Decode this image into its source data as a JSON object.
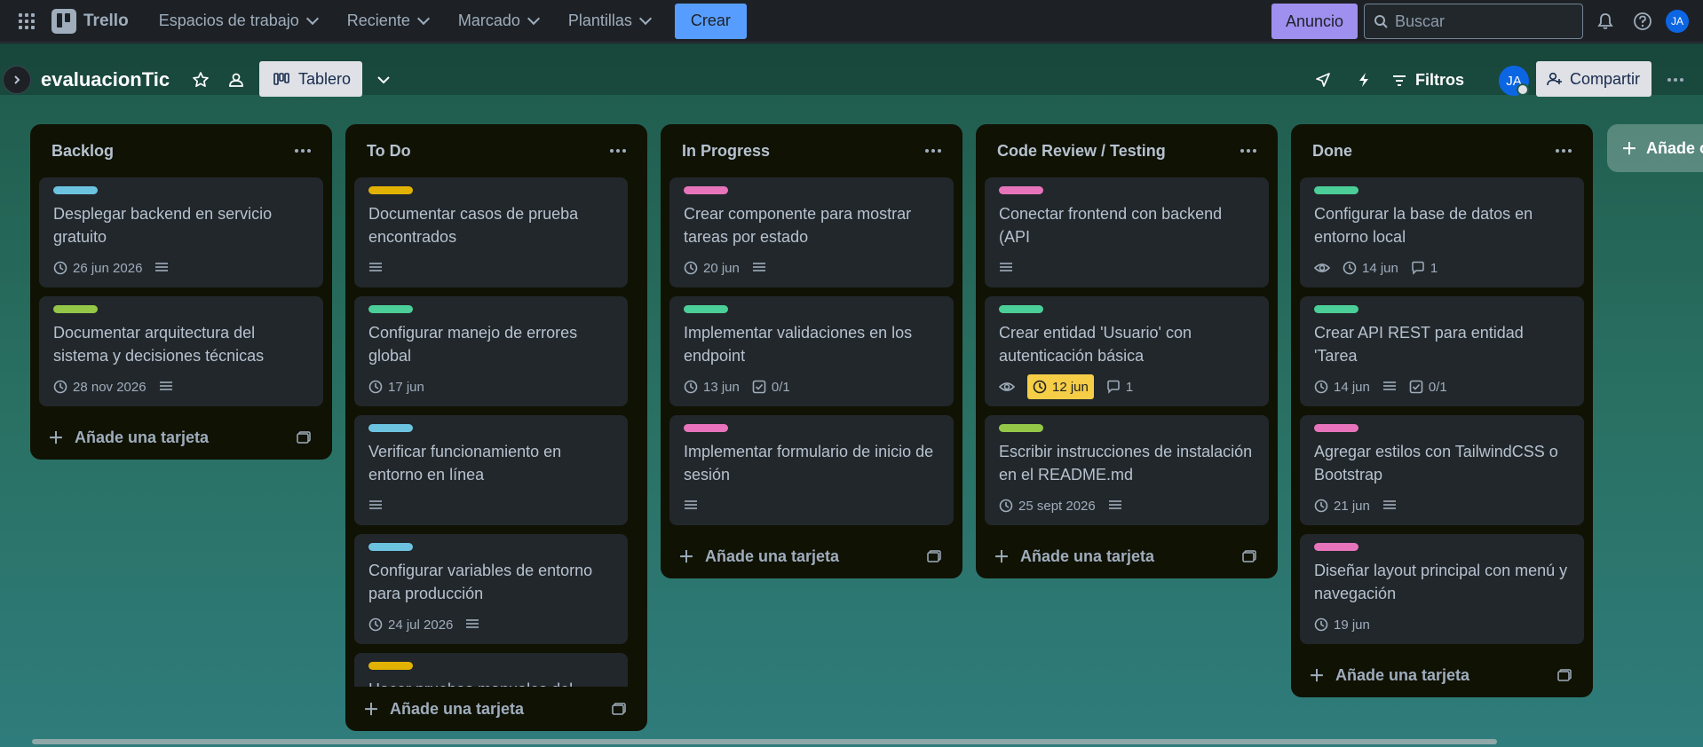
{
  "nav": {
    "app_name": "Trello",
    "menu": [
      {
        "label": "Espacios de trabajo"
      },
      {
        "label": "Reciente"
      },
      {
        "label": "Marcado"
      },
      {
        "label": "Plantillas"
      }
    ],
    "create_label": "Crear",
    "announce_label": "Anuncio",
    "search_placeholder": "Buscar",
    "user_initials": "JA"
  },
  "board": {
    "title": "evaluacionTic",
    "view_label": "Tablero",
    "filters_label": "Filtros",
    "member_initials": "JA",
    "share_label": "Compartir",
    "add_list_label": "Añade otra lista",
    "add_card_label": "Añade una tarjeta"
  },
  "colors": {
    "blue": "#6cc3e0",
    "yellow": "#e2b203",
    "green": "#4bce97",
    "lime": "#94c748",
    "pink": "#e774bb",
    "due_warning": "#f5cd47"
  },
  "lists": [
    {
      "title": "Backlog",
      "cards": [
        {
          "label_color": "#6cc3e0",
          "title": "Desplegar backend en servicio gratuito",
          "due": "26 jun 2026",
          "description": true
        },
        {
          "label_color": "#94c748",
          "title": "Documentar arquitectura del sistema y decisiones técnicas",
          "due": "28 nov 2026",
          "description": true
        }
      ]
    },
    {
      "title": "To Do",
      "cards": [
        {
          "label_color": "#e2b203",
          "title": "Documentar casos de prueba encontrados",
          "description": true
        },
        {
          "label_color": "#4bce97",
          "title": "Configurar manejo de errores global",
          "due": "17 jun"
        },
        {
          "label_color": "#6cc3e0",
          "title": "Verificar funcionamiento en entorno en línea",
          "description": true
        },
        {
          "label_color": "#6cc3e0",
          "title": "Configurar variables de entorno para producción",
          "due": "24 jul 2026",
          "description": true
        },
        {
          "label_color": "#e2b203",
          "title": "Hacer pruebas manuales del"
        }
      ]
    },
    {
      "title": "In Progress",
      "cards": [
        {
          "label_color": "#e774bb",
          "title": "Crear componente para mostrar tareas por estado",
          "due": "20 jun",
          "description": true
        },
        {
          "label_color": "#4bce97",
          "title": "Implementar validaciones en los endpoint",
          "due": "13 jun",
          "checklist": "0/1"
        },
        {
          "label_color": "#e774bb",
          "title": "Implementar formulario de inicio de sesión",
          "description": true
        }
      ]
    },
    {
      "title": "Code Review / Testing",
      "cards": [
        {
          "label_color": "#e774bb",
          "title": "Conectar frontend con backend (API",
          "description": true
        },
        {
          "label_color": "#4bce97",
          "title": "Crear entidad 'Usuario' con autenticación básica",
          "watch": true,
          "due": "12 jun",
          "due_warning": true,
          "comments": "1"
        },
        {
          "label_color": "#94c748",
          "title": "Escribir instrucciones de instalación en el README.md",
          "due": "25 sept 2026",
          "description": true
        }
      ]
    },
    {
      "title": "Done",
      "cards": [
        {
          "label_color": "#4bce97",
          "title": "Configurar la base de datos en entorno local",
          "watch": true,
          "due": "14 jun",
          "comments": "1"
        },
        {
          "label_color": "#4bce97",
          "title": "Crear API REST para entidad 'Tarea",
          "due": "14 jun",
          "description": true,
          "checklist": "0/1"
        },
        {
          "label_color": "#e774bb",
          "title": "Agregar estilos con TailwindCSS o Bootstrap",
          "due": "21 jun",
          "description": true
        },
        {
          "label_color": "#e774bb",
          "title": "Diseñar layout principal con menú y navegación",
          "due": "19 jun"
        }
      ]
    }
  ]
}
